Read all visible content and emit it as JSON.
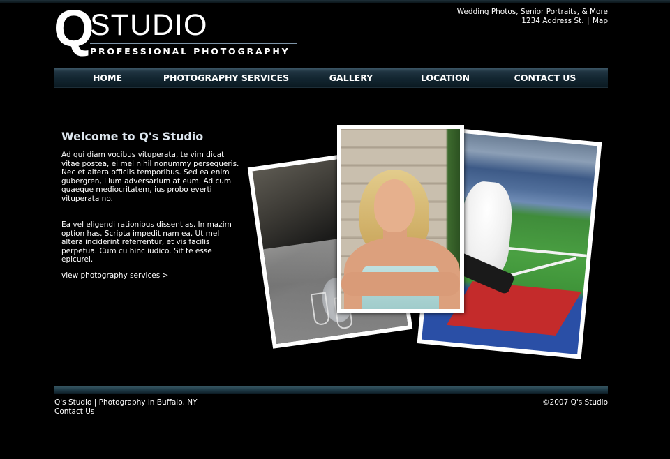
{
  "logo": {
    "letter": "Q",
    "word": "STUDIO",
    "tagline": "PROFESSIONAL PHOTOGRAPHY"
  },
  "header": {
    "services_line": "Wedding Photos, Senior Portraits, & More",
    "address": "1234 Address St.",
    "separator": "|",
    "map_link": "Map"
  },
  "nav": {
    "items": [
      {
        "label": "HOME"
      },
      {
        "label": "PHOTOGRAPHY SERVICES"
      },
      {
        "label": "GALLERY"
      },
      {
        "label": "LOCATION"
      },
      {
        "label": "CONTACT US"
      }
    ]
  },
  "main": {
    "title": "Welcome to Q's Studio",
    "paragraph1": "Ad qui diam vocibus vituperata, te vim dicat vitae postea, ei mel nihil nonummy persequeris. Nec et altera officiis temporibus. Sed ea enim gubergren, illum adversarium at eum. Ad cum quaeque mediocritatem, ius probo everti vituperata no.",
    "paragraph2": "Ea vel eligendi rationibus dissentias. In mazim option has. Scripta impedit nam ea. Ut mel altera inciderint referrentur, et vis facilis perpetua. Cum cu hinc iudico. Sit te esse epicurei.",
    "services_link": "view photography services >"
  },
  "footer": {
    "left_line": "Q's Studio | Photography in Buffalo, NY",
    "contact_link": "Contact Us",
    "copyright": "©2007 Q's Studio"
  },
  "colors": {
    "background": "#000000",
    "nav_bar": "#122530",
    "accent": "#3a5a66"
  }
}
